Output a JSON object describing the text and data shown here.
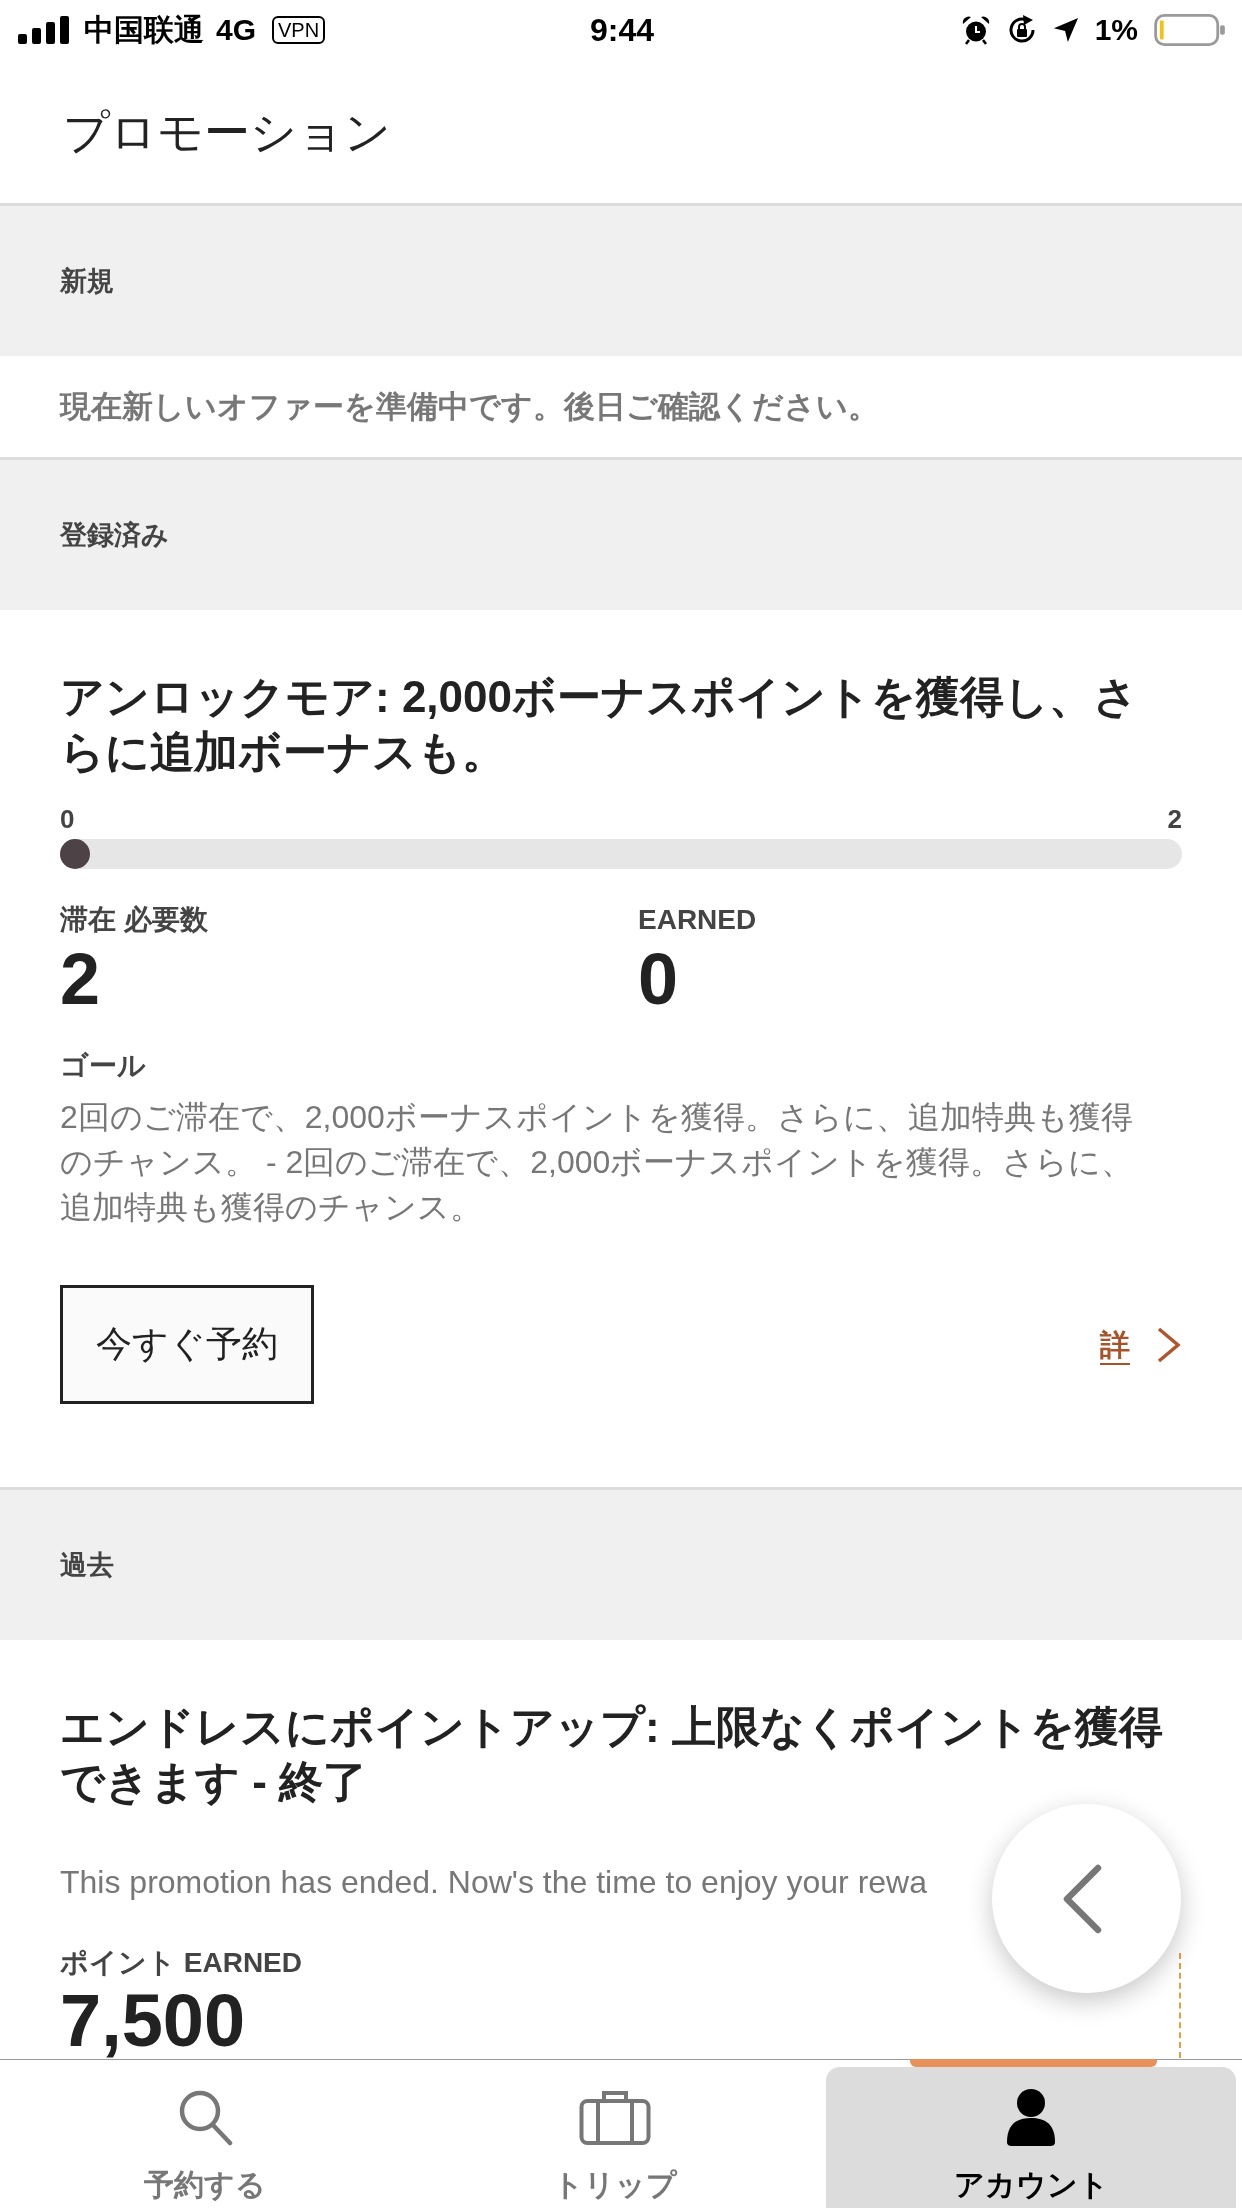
{
  "status_bar": {
    "carrier": "中国联通",
    "network": "4G",
    "vpn": "VPN",
    "time": "9:44",
    "battery_percent": "1%"
  },
  "header": {
    "title": "プロモーション"
  },
  "sections": [
    {
      "heading": "新規",
      "message": "現在新しいオファーを準備中です。後日ご確認ください。"
    },
    {
      "heading": "登録済み",
      "offers": [
        {
          "kind": "progress",
          "title": "アンロックモア: 2,000ボーナスポイントを獲得し、さらに追加ボーナスも。",
          "progress": {
            "min_label": "0",
            "max_label": "2",
            "level": 0
          },
          "stats": [
            {
              "label": "滞在 必要数",
              "value": "2"
            },
            {
              "label": "EARNED",
              "value": "0"
            }
          ],
          "goal_label": "ゴール",
          "goal_text": "2回のご滞在で、2,000ボーナスポイントを獲得。さらに、追加特典も獲得のチャンス。 - 2回のご滞在で、2,000ボーナスポイントを獲得。さらに、追加特典も獲得のチャンス。",
          "book_button": "今すぐ予約",
          "details_link": "詳"
        }
      ]
    },
    {
      "heading": "過去",
      "offers": [
        {
          "kind": "ended",
          "title": "エンドレスにポイントアップ: 上限なくポイントを獲得できます - 終了",
          "message": "This promotion has ended. Now's the time to enjoy your rewa",
          "stats": [
            {
              "label": "ポイント EARNED",
              "value": "7,500"
            }
          ]
        }
      ]
    }
  ],
  "tab_bar": {
    "tabs": [
      {
        "label": "予約する",
        "selected": false
      },
      {
        "label": "トリップ",
        "selected": false
      },
      {
        "label": "アカウント",
        "selected": true
      }
    ]
  }
}
